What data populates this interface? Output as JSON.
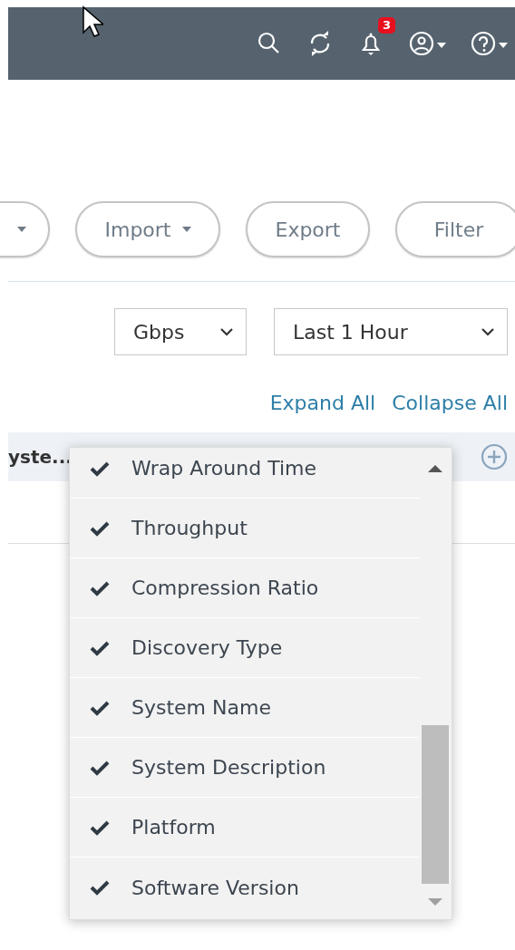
{
  "header": {
    "notification_badge": "3"
  },
  "toolbar": {
    "buttons": [
      {
        "dropdown": true
      },
      {
        "label": "Import",
        "dropdown": true
      },
      {
        "label": "Export",
        "dropdown": false
      },
      {
        "label": "Filter",
        "dropdown": false
      }
    ]
  },
  "selects": [
    {
      "value": "Gbps"
    },
    {
      "value": "Last 1 Hour"
    }
  ],
  "links": [
    "Expand All",
    "Collapse All"
  ],
  "table": {
    "columns": [
      {
        "label": "yste..."
      }
    ]
  },
  "column_menu": {
    "items": [
      {
        "label": "Wrap Around Time",
        "checked": true
      },
      {
        "label": "Throughput",
        "checked": true
      },
      {
        "label": "Compression Ratio",
        "checked": true
      },
      {
        "label": "Discovery Type",
        "checked": true
      },
      {
        "label": "System Name",
        "checked": true
      },
      {
        "label": "System Description",
        "checked": true
      },
      {
        "label": "Platform",
        "checked": true
      },
      {
        "label": "Software Version",
        "checked": true
      }
    ]
  }
}
